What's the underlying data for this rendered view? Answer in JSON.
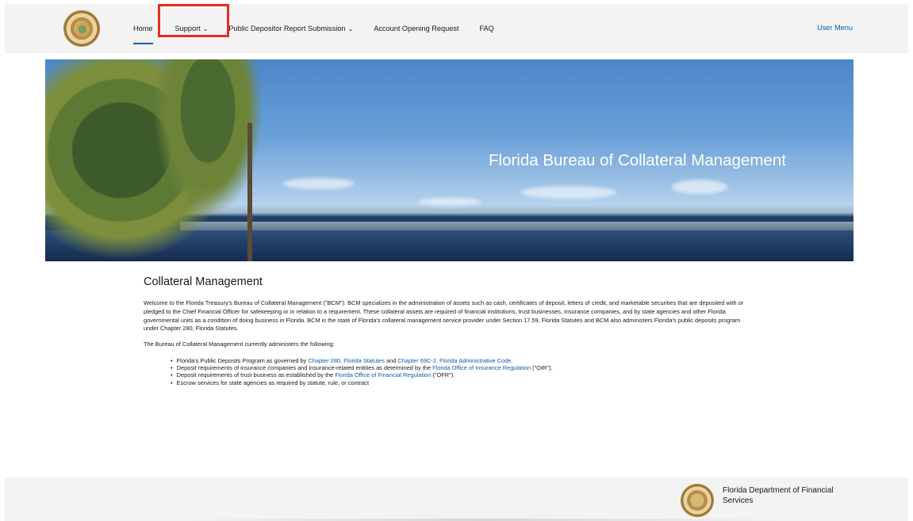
{
  "nav": {
    "items": [
      {
        "label": "Home",
        "dropdown": false,
        "active": true
      },
      {
        "label": "Support",
        "dropdown": true,
        "active": false
      },
      {
        "label": "Public Depositor Report Submission",
        "dropdown": true,
        "active": false
      },
      {
        "label": "Account Opening Request",
        "dropdown": false,
        "active": false
      },
      {
        "label": "FAQ",
        "dropdown": false,
        "active": false
      }
    ],
    "user_menu": "User Menu",
    "chevron": "⌄"
  },
  "hero": {
    "title": "Florida Bureau of Collateral Management"
  },
  "main": {
    "heading": "Collateral Management",
    "intro": "Welcome to the Florida Treasury's Bureau of Collateral Management (\"BCM\"). BCM specializes in the administration of assets such as cash, certificates of deposit, letters of credit, and marketable securities that are deposited with or pledged to the Chief Financial Officer for safekeeping or in relation to a requirement. These collateral assets are required of financial institutions, trust businesses, insurance companies, and by state agencies and other Florida governmental units as a condition of doing business in Florida. BCM is the state of Florida's collateral management service provider under Section 17.59, Florida Statutes and BCM also administers Florida's public deposits program under Chapter 280, Florida Statutes.",
    "list_intro": "The Bureau of Collateral Management currently administers the following:",
    "bullets": [
      {
        "pre": "Florida's Public Deposits Program as governed by ",
        "link1": "Chapter 280, Florida Statutes",
        "mid": " and ",
        "link2": "Chapter 69C-2, Florida Administrative Code",
        "post": "."
      },
      {
        "pre": "Deposit requirements of insurance companies and insurance-related entities as determined by the ",
        "link1": "Florida Office of Insurance Regulation",
        "post": " (\"OIR\")."
      },
      {
        "pre": "Deposit requirements of trust business as established by the ",
        "link1": "Florida Office of Financial Regulation",
        "post": " (\"OFR\")."
      },
      {
        "pre": "Escrow services for state agencies as required by statute, rule, or contract"
      }
    ]
  },
  "footer": {
    "org_name": "Florida Department of Financial Services"
  },
  "colors": {
    "link": "#0b5cab",
    "highlight_box": "#e0301e",
    "bar_bg": "#f3f3f3"
  },
  "icons": [
    "florida-seal-icon",
    "chevron-down-icon"
  ]
}
